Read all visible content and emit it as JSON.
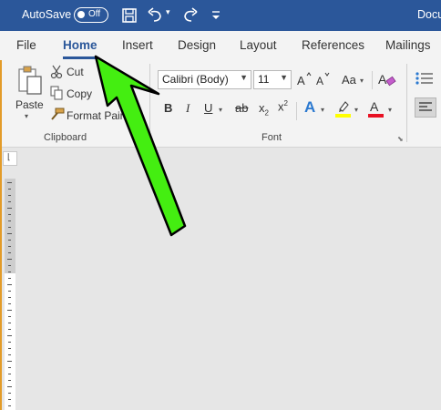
{
  "titlebar": {
    "autosave_label": "AutoSave",
    "autosave_state": "Off",
    "doc_title": "Docu",
    "background": "#2b579a",
    "icons": [
      "save-icon",
      "undo-icon",
      "redo-icon",
      "customize-quick-access-icon"
    ]
  },
  "tabs": [
    {
      "label": "File"
    },
    {
      "label": "Home",
      "active": true
    },
    {
      "label": "Insert"
    },
    {
      "label": "Design"
    },
    {
      "label": "Layout"
    },
    {
      "label": "References"
    },
    {
      "label": "Mailings"
    }
  ],
  "clipboard": {
    "paste_label": "Paste",
    "cut_label": "Cut",
    "copy_label": "Copy",
    "format_painter_label": "Format Painter",
    "group_label": "Clipboard"
  },
  "font": {
    "font_name": "Calibri (Body)",
    "font_size": "11",
    "change_case_label": "Aa",
    "bold": "B",
    "italic": "I",
    "underline": "U",
    "strikethrough": "ab",
    "subscript": "x",
    "superscript": "x",
    "text_effects": "A",
    "font_color_letter": "A",
    "highlight_color": "#ffff00",
    "font_color": "#e81123",
    "group_label": "Font"
  },
  "overlay": {
    "arrow_color": "#44ee11"
  }
}
